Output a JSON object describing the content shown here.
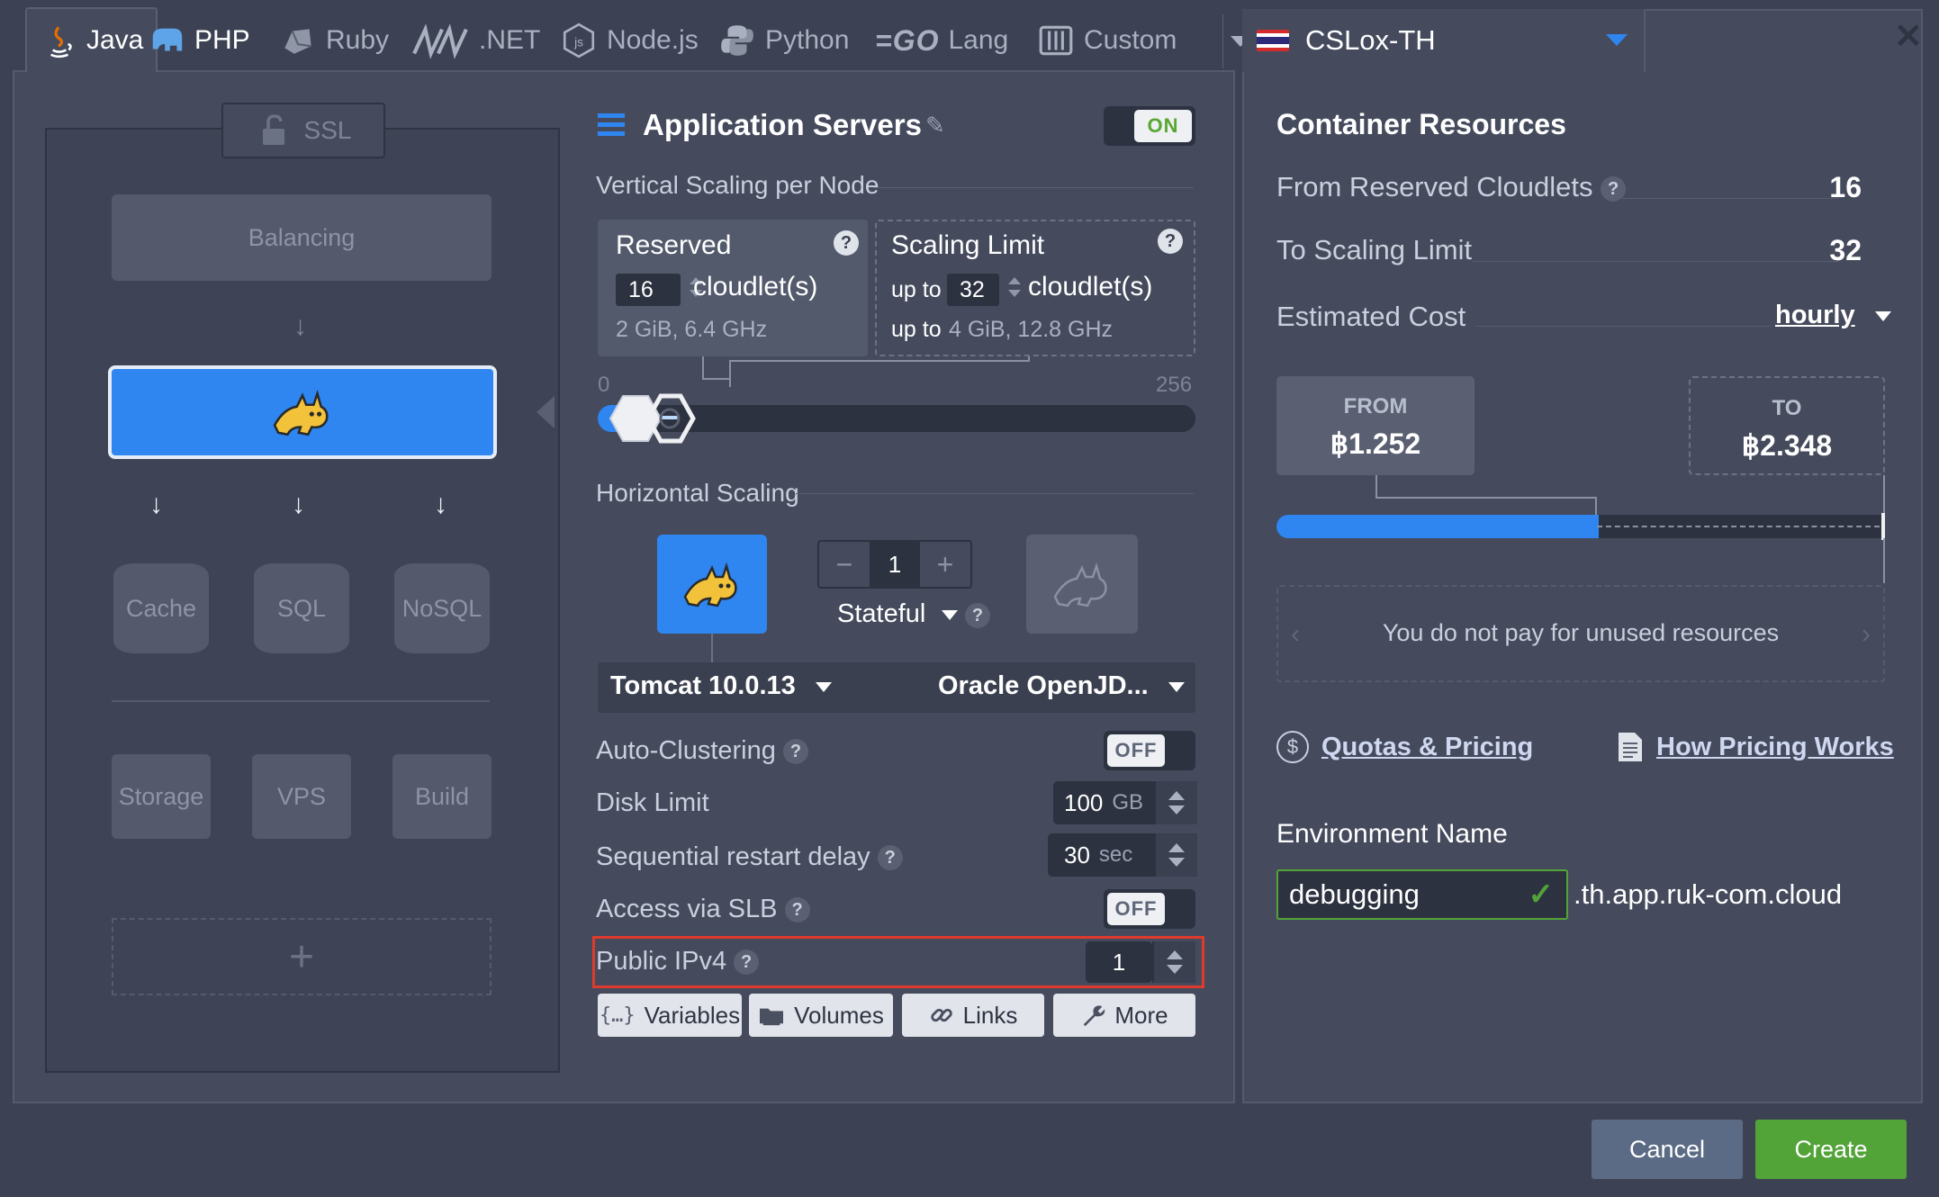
{
  "tabs": [
    {
      "label": "Java",
      "icon": "java-icon"
    },
    {
      "label": "PHP",
      "icon": "php-elephant-icon"
    },
    {
      "label": "Ruby",
      "icon": "ruby-icon"
    },
    {
      "label": ".NET",
      "icon": "dotnet-icon"
    },
    {
      "label": "Node.js",
      "icon": "nodejs-icon"
    },
    {
      "label": "Python",
      "icon": "python-icon"
    },
    {
      "label": "Lang",
      "logo_text": "GO",
      "icon": "go-icon"
    },
    {
      "label": "Custom",
      "icon": "docker-custom-icon"
    }
  ],
  "topology": {
    "ssl": "SSL",
    "balancing": "Balancing",
    "cache": "Cache",
    "sql": "SQL",
    "nosql": "NoSQL",
    "storage": "Storage",
    "vps": "VPS",
    "build": "Build",
    "add": "+"
  },
  "app_servers": {
    "title": "Application Servers",
    "toggle": "ON",
    "vertical_title": "Vertical Scaling per Node",
    "reserved": {
      "title": "Reserved",
      "value": "16",
      "unit": "cloudlet(s)",
      "spec": "2 GiB, 6.4 GHz"
    },
    "limit": {
      "title": "Scaling Limit",
      "up_to": "up to",
      "value": "32",
      "unit": "cloudlet(s)",
      "spec_prefix": "up to",
      "spec": "4 GiB, 12.8 GHz"
    },
    "slider": {
      "min": "0",
      "max": "256",
      "reserved": 16,
      "limit": 32
    },
    "horizontal_title": "Horizontal Scaling",
    "node_count": "1",
    "minus": "−",
    "plus": "+",
    "mode": "Stateful",
    "version": "Tomcat 10.0.13",
    "jdk": "Oracle OpenJD...",
    "auto_clustering": {
      "label": "Auto-Clustering",
      "value": "OFF"
    },
    "disk_limit": {
      "label": "Disk Limit",
      "value": "100",
      "unit": "GB"
    },
    "restart_delay": {
      "label": "Sequential restart delay",
      "value": "30",
      "unit": "sec"
    },
    "slb": {
      "label": "Access via SLB",
      "value": "OFF"
    },
    "ipv4": {
      "label": "Public IPv4",
      "value": "1"
    },
    "buttons": {
      "variables": "Variables",
      "volumes": "Volumes",
      "links": "Links",
      "more": "More"
    }
  },
  "region": {
    "name": "CSLox-TH",
    "flag": "thailand-flag-icon"
  },
  "resources": {
    "title": "Container Resources",
    "from_label": "From Reserved Cloudlets",
    "from_value": "16",
    "to_label": "To Scaling Limit",
    "to_value": "32",
    "cost_label": "Estimated Cost",
    "cost_period": "hourly",
    "from_box_label": "FROM",
    "from_price": "฿1.252",
    "to_box_label": "TO",
    "to_price": "฿2.348",
    "bar_fill": 0.53,
    "note": "You do not pay for unused resources",
    "quotas_link": "Quotas & Pricing",
    "how_link": "How Pricing Works"
  },
  "environment": {
    "label": "Environment Name",
    "value": "debugging",
    "domain": ".th.app.ruk-com.cloud"
  },
  "footer": {
    "cancel": "Cancel",
    "create": "Create"
  },
  "colors": {
    "accent_blue": "#2f86f0",
    "create_green": "#52a338",
    "highlight_red": "#e03a2c"
  }
}
